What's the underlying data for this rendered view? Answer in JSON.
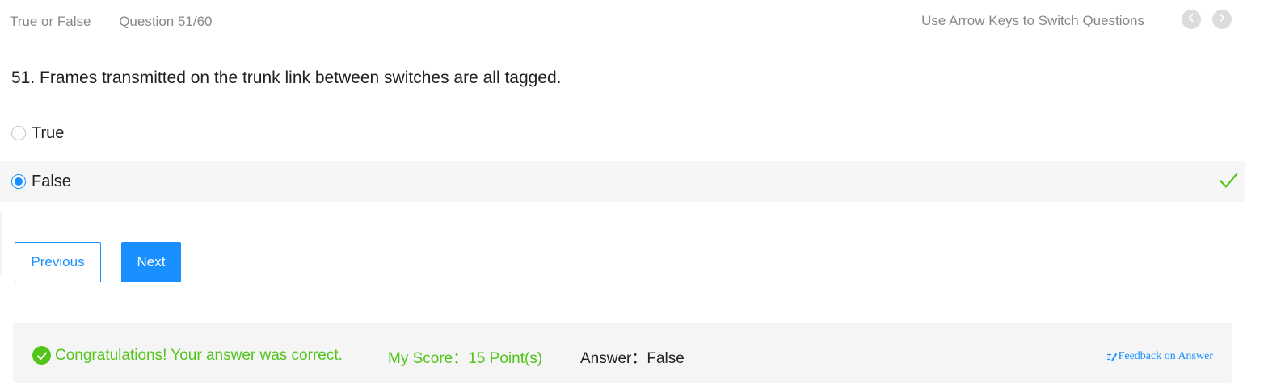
{
  "header": {
    "question_type": "True or False",
    "progress": "Question 51/60",
    "hint": "Use Arrow Keys to Switch Questions"
  },
  "question": {
    "text": "51. Frames transmitted on the trunk link between switches are all tagged.",
    "options": [
      {
        "label": "True",
        "selected": false
      },
      {
        "label": "False",
        "selected": true,
        "correct": true
      }
    ]
  },
  "buttons": {
    "previous": "Previous",
    "next": "Next"
  },
  "result": {
    "message": "Congratulations! Your answer was correct.",
    "score_label": "My Score：",
    "score_value": "15 Point(s)",
    "answer_label": "Answer：",
    "answer_value": "False",
    "feedback": "Feedback on Answer"
  },
  "colors": {
    "accent": "#1890ff",
    "success": "#52c41a",
    "muted": "#888888",
    "panel_bg": "#f5f5f5"
  },
  "icons": [
    "chevron-left-icon",
    "chevron-right-icon",
    "checkmark-icon",
    "success-check-icon",
    "feedback-edit-icon"
  ]
}
